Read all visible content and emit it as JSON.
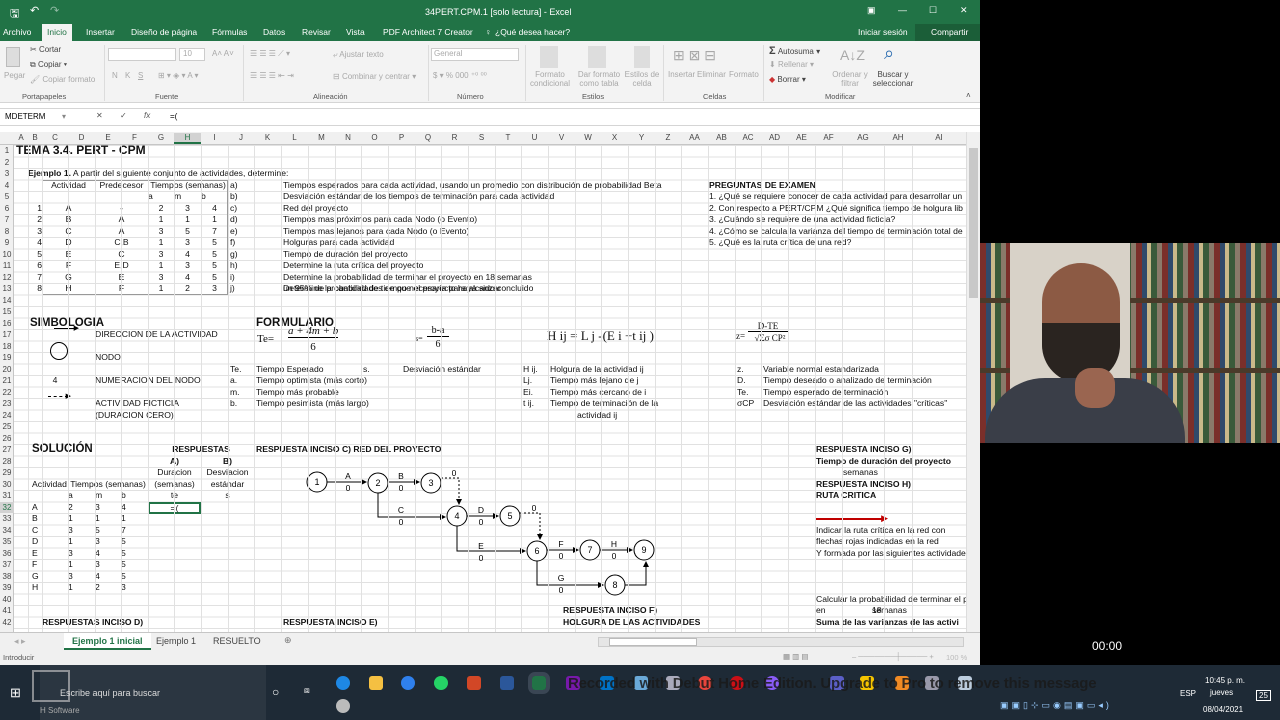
{
  "window": {
    "title": "34PERT.CPM.1  [solo lectura]  -  Excel",
    "controls": [
      "▣",
      "—",
      "☐",
      "✕"
    ]
  },
  "ribbon_tabs": [
    "Archivo",
    "Inicio",
    "Insertar",
    "Diseño de página",
    "Fórmulas",
    "Datos",
    "Revisar",
    "Vista",
    "PDF Architect 7 Creator"
  ],
  "tell_me": "¿Qué desea hacer?",
  "signin": "Iniciar sesión",
  "share": "Compartir",
  "ribbon": {
    "clipboard": {
      "paste": "Pegar",
      "cut": "Cortar",
      "copy": "Copiar",
      "format_painter": "Copiar formato",
      "group": "Portapapeles"
    },
    "font": {
      "size": "10",
      "group": "Fuente",
      "bold": "N",
      "italic": "K",
      "underline": "S"
    },
    "alignment": {
      "wrap": "Ajustar texto",
      "merge": "Combinar y centrar",
      "group": "Alineación"
    },
    "number": {
      "format": "General",
      "group": "Número"
    },
    "styles": {
      "cond": "Formato condicional",
      "table": "Dar formato como tabla",
      "cell": "Estilos de celda",
      "group": "Estilos"
    },
    "cells": {
      "insert": "Insertar",
      "delete": "Eliminar",
      "format": "Formato",
      "group": "Celdas"
    },
    "editing": {
      "autosum": "Autosuma",
      "fill": "Rellenar",
      "clear": "Borrar",
      "sort": "Ordenar y filtrar",
      "find": "Buscar y seleccionar",
      "group": "Modificar"
    }
  },
  "formula_bar": {
    "name_box": "MDETERM",
    "formula": "=("
  },
  "columns": [
    "A",
    "B",
    "C",
    "D",
    "E",
    "F",
    "G",
    "H",
    "I",
    "J",
    "K",
    "L",
    "M",
    "N",
    "O",
    "P",
    "Q",
    "R",
    "S",
    "T",
    "U",
    "V",
    "W",
    "X",
    "Y",
    "Z",
    "AA",
    "AB",
    "AC",
    "AD",
    "AE",
    "AF",
    "AG",
    "AH",
    "AI"
  ],
  "rows": [
    "1",
    "2",
    "3",
    "4",
    "5",
    "6",
    "7",
    "8",
    "9",
    "10",
    "11",
    "12",
    "13",
    "14",
    "15",
    "16",
    "17",
    "18",
    "19",
    "20",
    "21",
    "22",
    "23",
    "24",
    "25",
    "26",
    "27",
    "28",
    "29",
    "30",
    "31",
    "32",
    "33",
    "34",
    "35",
    "36",
    "37",
    "38",
    "39",
    "40",
    "41",
    "42"
  ],
  "sheet": {
    "title": "TEMA 3.4. PERT - CPM",
    "example_bold": "Ejemplo 1.",
    "example_text": "A partir del siguiente conjunto de actividades, determine:",
    "table_headers": {
      "actividad": "Actividad",
      "predecesor": "Predecesor",
      "tiempos": "Tiempos (semanas)",
      "a": "a",
      "m": "m",
      "b": "b"
    },
    "activities": [
      {
        "n": "1",
        "act": "A",
        "pred": "-",
        "a": "2",
        "m": "3",
        "b": "4"
      },
      {
        "n": "2",
        "act": "B",
        "pred": "A",
        "a": "1",
        "m": "1",
        "b": "1"
      },
      {
        "n": "3",
        "act": "C",
        "pred": "A",
        "a": "3",
        "m": "5",
        "b": "7"
      },
      {
        "n": "4",
        "act": "D",
        "pred": "C,B",
        "a": "1",
        "m": "3",
        "b": "5"
      },
      {
        "n": "5",
        "act": "E",
        "pred": "C",
        "a": "3",
        "m": "4",
        "b": "5"
      },
      {
        "n": "6",
        "act": "F",
        "pred": "E,D",
        "a": "1",
        "m": "3",
        "b": "5"
      },
      {
        "n": "7",
        "act": "G",
        "pred": "E",
        "a": "3",
        "m": "4",
        "b": "5"
      },
      {
        "n": "8",
        "act": "H",
        "pred": "F",
        "a": "1",
        "m": "2",
        "b": "3"
      }
    ],
    "tasks": [
      {
        "k": "a)",
        "t": "Tiempos esperados para cada actividad, usando un promedio con distribución de probabilidad Beta"
      },
      {
        "k": "b)",
        "t": "Desviación estándar de los tiempos de terminación para cada actividad"
      },
      {
        "k": "c)",
        "t": "Red del proyecto"
      },
      {
        "k": "d)",
        "t": "Tiempos mas próximos para cada Nodo (o Evento)"
      },
      {
        "k": "e)",
        "t": "Tiempos mas lejanos para cada Nodo (o Evento)"
      },
      {
        "k": "f)",
        "t": "Holguras para cada actividad"
      },
      {
        "k": "g)",
        "t": "Tiempo de duración del proyecto"
      },
      {
        "k": "h)",
        "t": "Determine la ruta crítica del proyecto"
      },
      {
        "k": "i)",
        "t": "Determine la probabilidad de terminar el proyecto en"
      },
      {
        "k": "j)",
        "t": "Determine la cantidad de tiempo necesaria para alcanzar"
      }
    ],
    "task_i_value": "18",
    "task_i_unit": "semanas",
    "task_j_cont": "un 95% de probabilidades de que el proyecto haya sido concluido",
    "exam_title": "PREGUNTAS DE EXAMEN",
    "exam": [
      "1. ¿Qué se requiere conocer de cada actividad para desarrollar un",
      "2. Con respecto a PERT/CPM ¿Qué significa tiempo de holgura lib",
      "3. ¿Cuándo se requiere de una actividad ficticia?",
      "4. ¿Cómo se calcula la varianza del tiempo de terminación total de",
      "5. ¿Qué es la ruta crítica de una red?"
    ],
    "simbologia": {
      "title": "SIMBOLOGIA",
      "dir": "DIRECCION DE LA ACTIVIDAD",
      "node": "NODO",
      "num_sample": "4",
      "num": "NUMERACION DEL NODO",
      "fict1": "ACTIVIDAD FICTICIA",
      "fict2": "(DURACION CERO)"
    },
    "formulario": {
      "title": "FORMULARIO",
      "te_lhs": "Te=",
      "te_num": "a + 4m + b",
      "te_den": "6",
      "s_lhs": "s=",
      "s_num": "b-a",
      "s_den": "6",
      "h_formula": "H ij = L j -(E i +t ij )",
      "z_lhs": "z=",
      "z_num": "D-TE",
      "z_den": "√Σσ CP²",
      "defs": [
        {
          "k": "Te.",
          "t": "Tiempo Esperado"
        },
        {
          "k": "a.",
          "t": "Tiempo optimista (más corto)"
        },
        {
          "k": "m.",
          "t": "Tiempo más probable"
        },
        {
          "k": "b.",
          "t": "Tiempo pesimista (más largo)"
        }
      ],
      "s_def": {
        "k": "s.",
        "t": "Desviación estándar"
      },
      "h_defs": [
        {
          "k": "H ij.",
          "t": "Holgura de la actividad ij"
        },
        {
          "k": "Lj.",
          "t": "Tiempo más lejano de j"
        },
        {
          "k": "Ei.",
          "t": "Tiempo más cercano de i"
        },
        {
          "k": "t ij.",
          "t": "Tiempo de terminación de la"
        }
      ],
      "h_def_cont": "actividad ij",
      "z_defs": [
        {
          "k": "z.",
          "t": "Variable normal estandarizada"
        },
        {
          "k": "D.",
          "t": "Tiempo deseado o analizado de terminación"
        },
        {
          "k": "Te.",
          "t": "Tiempo esperado de terminación"
        },
        {
          "k": "σCP",
          "t": "Desviación estándar de las actividades \"críticas\""
        }
      ]
    },
    "solucion": {
      "title": "SOLUCIÓN",
      "respuestas": "RESPUESTAS",
      "a_hdr": "A)",
      "b_hdr": "B)",
      "a_l1": "Duracion",
      "a_l2": "(semanas)",
      "a_l3": "te",
      "b_l1": "Desviacion",
      "b_l2": "estándar",
      "b_l3": "s",
      "act": "Actividad",
      "tiempos": "Tiempos (semanas)",
      "a": "a",
      "m": "m",
      "b": "b",
      "editing": "=(",
      "rows": [
        [
          "A",
          "2",
          "3",
          "4"
        ],
        [
          "B",
          "1",
          "1",
          "1"
        ],
        [
          "C",
          "3",
          "5",
          "7"
        ],
        [
          "D",
          "1",
          "3",
          "5"
        ],
        [
          "E",
          "3",
          "4",
          "5"
        ],
        [
          "F",
          "1",
          "3",
          "5"
        ],
        [
          "G",
          "3",
          "4",
          "5"
        ],
        [
          "H",
          "1",
          "2",
          "3"
        ]
      ]
    },
    "inciso_c": "RESPUESTA INCISO C) RED DEL PROYECTO",
    "inciso_d": "RESPUESTAS INCISO D)",
    "inciso_e": "RESPUESTA INCISO E)",
    "inciso_f": "RESPUESTA INCISO F)",
    "inciso_f2": "HOLGURA DE LAS ACTIVIDADES",
    "inciso_g": "RESPUESTA INCISO G)",
    "inciso_g2": "Tiempo de duración del proyecto",
    "inciso_g3": "semanas",
    "inciso_h": "RESPUESTA INCISO H)",
    "inciso_h2": "RUTA CRITICA",
    "h_note": [
      "Indicar la ruta crítica en la red con",
      "flechas rojas indicadas en la red",
      "Y formada por las siguientes actividade"
    ],
    "i_note": "Calcular la probabilidad de terminar el p",
    "i_en": "en",
    "i_val": "18",
    "i_unit": "semanas",
    "i_sum": "Suma de las varianzas de las activi",
    "network": {
      "nodes": [
        "1",
        "2",
        "3",
        "4",
        "5",
        "6",
        "7",
        "8",
        "9"
      ],
      "edges": [
        {
          "l": "A",
          "v": "0"
        },
        {
          "l": "B",
          "v": "0"
        },
        {
          "l": "C",
          "v": "0"
        },
        {
          "l": "D",
          "v": "0"
        },
        {
          "l": "E",
          "v": "0"
        },
        {
          "l": "F",
          "v": "0"
        },
        {
          "l": "G",
          "v": "0"
        },
        {
          "l": "H",
          "v": "0"
        }
      ],
      "dummy": [
        "0",
        "0"
      ]
    },
    "critical_color": "#c00000"
  },
  "sheet_tabs": [
    "Ejemplo 1 inicial",
    "Ejemplo 1",
    "RESUELTO"
  ],
  "status": {
    "mode": "Introducir",
    "zoom": "100 %"
  },
  "video": {
    "timer": "00:00"
  },
  "taskbar": {
    "search": "Escribe aquí para buscar",
    "brand": "H Software",
    "watermark": "Recorded with Debut Home Edition. Upgrade to Pro to remove this message",
    "lang": "ESP",
    "time": "10:45 p. m.",
    "day": "jueves",
    "date": "08/04/2021",
    "notif": "25"
  }
}
